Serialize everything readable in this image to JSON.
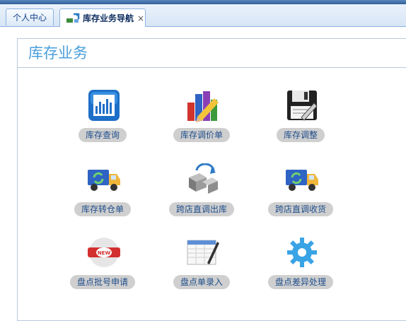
{
  "tabs": [
    {
      "label": "个人中心"
    },
    {
      "label": "库存业务导航",
      "close": "×"
    }
  ],
  "section": {
    "title": "库存业务"
  },
  "items": [
    {
      "label": "库存查询",
      "icon": "chart-icon"
    },
    {
      "label": "库存调价单",
      "icon": "bar-pencil-icon"
    },
    {
      "label": "库存调整",
      "icon": "floppy-edit-icon"
    },
    {
      "label": "库存转仓单",
      "icon": "truck-icon"
    },
    {
      "label": "跨店直调出库",
      "icon": "transfer-box-icon"
    },
    {
      "label": "跨店直调收货",
      "icon": "truck-icon"
    },
    {
      "label": "盘点批号申请",
      "icon": "new-badge-icon"
    },
    {
      "label": "盘点单录入",
      "icon": "sheet-pen-icon"
    },
    {
      "label": "盘点差异处理",
      "icon": "gear-icon"
    }
  ],
  "colors": {
    "accent": "#4a9fdc",
    "tab_border": "#8db2e3",
    "label_bg": "#cfcfcf"
  }
}
